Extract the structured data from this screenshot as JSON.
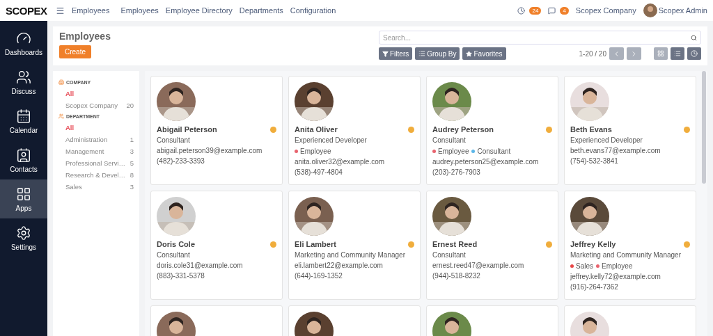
{
  "topbar": {
    "logo": "SCOPEX",
    "app": "Employees",
    "menu": [
      "Employees",
      "Employee Directory",
      "Departments",
      "Configuration"
    ],
    "activity_count": "24",
    "message_count": "4",
    "company": "Scopex Company",
    "user": "Scopex Admin"
  },
  "sidebar": [
    {
      "label": "Dashboards",
      "selected": false
    },
    {
      "label": "Discuss",
      "selected": false
    },
    {
      "label": "Calendar",
      "selected": false
    },
    {
      "label": "Contacts",
      "selected": false
    },
    {
      "label": "Apps",
      "selected": true
    },
    {
      "label": "Settings",
      "selected": false
    }
  ],
  "control_panel": {
    "title": "Employees",
    "create": "Create",
    "search_placeholder": "Search...",
    "filters": "Filters",
    "group_by": "Group By",
    "favorites": "Favorites",
    "pager": "1-20 / 20",
    "views": [
      {
        "selected": true
      },
      {
        "selected": false
      },
      {
        "selected": false
      }
    ]
  },
  "filter_panel": [
    {
      "heading": "COMPANY",
      "items": [
        {
          "label": "All",
          "selected": true
        },
        {
          "label": "Scopex Company",
          "count": "20",
          "selected": false
        }
      ]
    },
    {
      "heading": "DEPARTMENT",
      "items": [
        {
          "label": "All",
          "selected": true
        },
        {
          "label": "Administration",
          "count": "1",
          "selected": false
        },
        {
          "label": "Management",
          "count": "3",
          "selected": false
        },
        {
          "label": "Professional Servi…",
          "count": "5",
          "selected": false
        },
        {
          "label": "Research & Devel…",
          "count": "8",
          "selected": false
        },
        {
          "label": "Sales",
          "count": "3",
          "selected": false
        }
      ]
    }
  ],
  "employees": [
    {
      "kind": "full",
      "name": "Abigail Peterson",
      "job": "Consultant",
      "email": "abigail.peterson39@example.com",
      "phone": "(482)-233-3393"
    },
    {
      "kind": "full",
      "name": "Anita Oliver",
      "job": "Experienced Developer",
      "tags": [
        {
          "label": "Employee",
          "color": "#e8636e"
        }
      ],
      "email": "anita.oliver32@example.com",
      "phone": "(538)-497-4804"
    },
    {
      "kind": "full",
      "name": "Audrey Peterson",
      "job": "Consultant",
      "tags": [
        {
          "label": "Employee",
          "color": "#e8636e"
        },
        {
          "label": "Consultant",
          "color": "#5cb6e8"
        }
      ],
      "email": "audrey.peterson25@example.com",
      "phone": "(203)-276-7903"
    },
    {
      "kind": "full",
      "name": "Beth Evans",
      "job": "Experienced Developer",
      "email": "beth.evans77@example.com",
      "phone": "(754)-532-3841"
    },
    {
      "kind": "full",
      "name": "Doris Cole",
      "job": "Consultant",
      "email": "doris.cole31@example.com",
      "phone": "(883)-331-5378"
    },
    {
      "kind": "full",
      "name": "Eli Lambert",
      "job": "Marketing and Community Manager",
      "email": "eli.lambert22@example.com",
      "phone": "(644)-169-1352"
    },
    {
      "kind": "full",
      "name": "Ernest Reed",
      "job": "Consultant",
      "email": "ernest.reed47@example.com",
      "phone": "(944)-518-8232"
    },
    {
      "kind": "full",
      "name": "Jeffrey Kelly",
      "job": "Marketing and Community Manager",
      "tags": [
        {
          "label": "Sales",
          "color": "#e84848"
        },
        {
          "label": "Employee",
          "color": "#e8636e"
        }
      ],
      "email": "jeffrey.kelly72@example.com",
      "phone": "(916)-264-7362"
    },
    {
      "kind": "cut"
    },
    {
      "kind": "cut"
    },
    {
      "kind": "cut"
    },
    {
      "kind": "cut"
    }
  ]
}
